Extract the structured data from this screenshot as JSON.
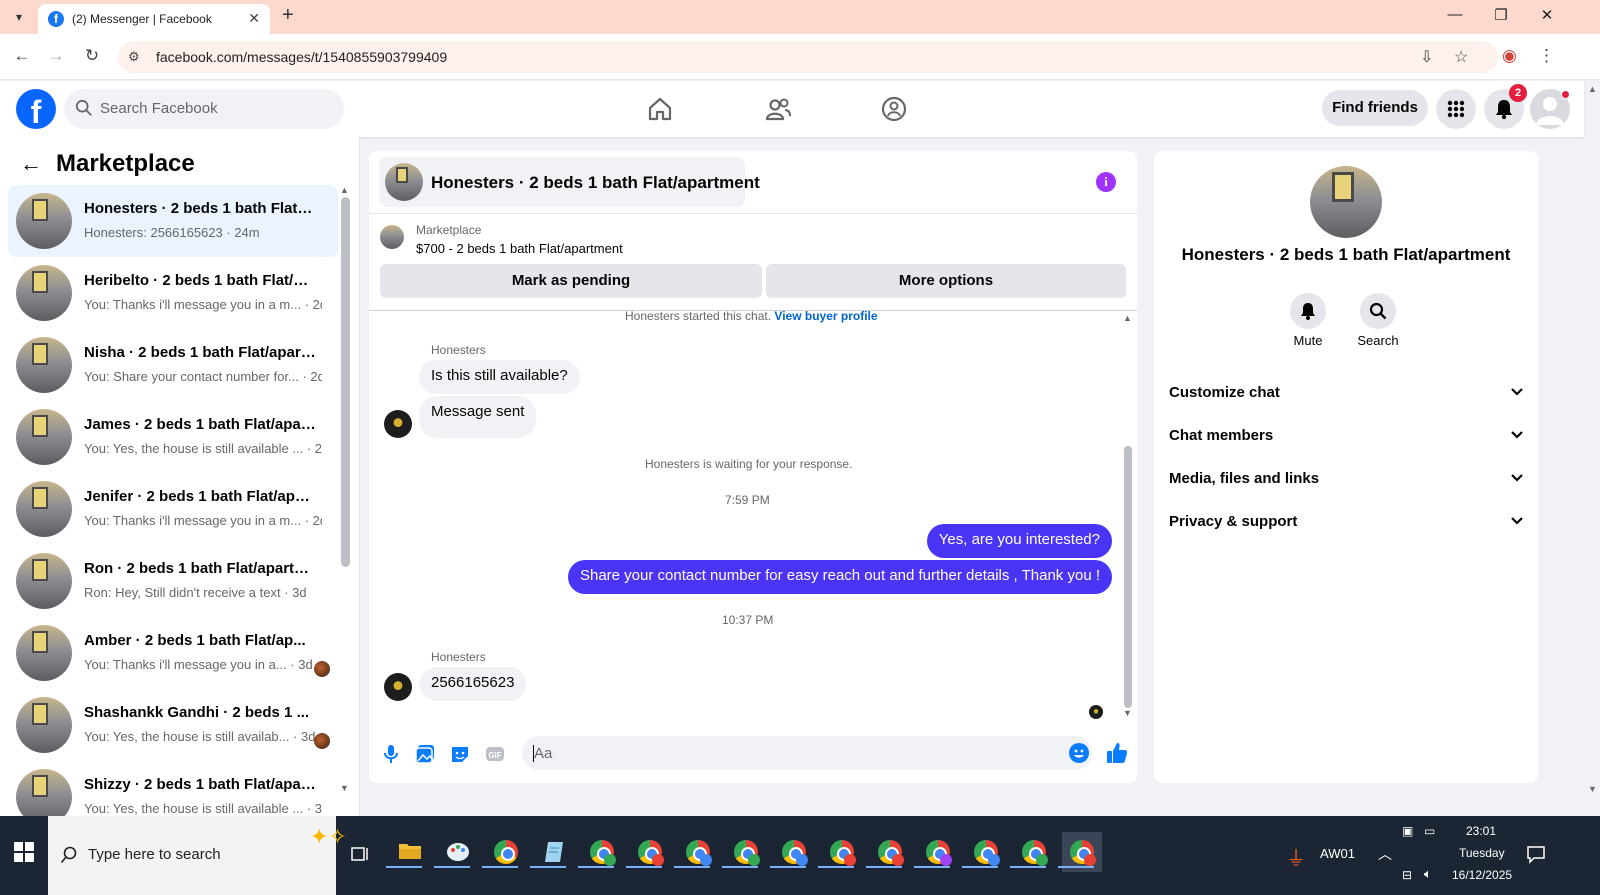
{
  "browser": {
    "tab_title": "(2) Messenger | Facebook",
    "url": "facebook.com/messages/t/1540855903799409",
    "new_tab_glyph": "+",
    "close_glyph": "✕",
    "minimize_glyph": "—",
    "maximize_glyph": "❐",
    "window_close_glyph": "✕"
  },
  "fb_header": {
    "logo": "f",
    "search_placeholder": "Search Facebook",
    "find_friends": "Find friends",
    "notification_count": "2"
  },
  "left_panel": {
    "back_glyph": "←",
    "title": "Marketplace",
    "conversations": [
      {
        "name": "Honesters · 2 beds 1 bath Flat/a...",
        "preview": "Honesters: 2566165623 · 24m",
        "active": true
      },
      {
        "name": "Heribelto · 2 beds 1 bath Flat/ap...",
        "preview": "You: Thanks i'll message you in a m... · 2d"
      },
      {
        "name": "Nisha · 2 beds 1 bath Flat/apart...",
        "preview": "You: Share your contact number for... · 2d"
      },
      {
        "name": "James · 2 beds 1 bath Flat/apart...",
        "preview": "You: Yes, the house is still available ... · 2d"
      },
      {
        "name": "Jenifer · 2 beds 1 bath Flat/apart...",
        "preview": "You: Thanks i'll message you in a m... · 2d"
      },
      {
        "name": "Ron · 2 beds 1 bath Flat/apartm...",
        "preview": "Ron: Hey, Still didn't receive a text · 3d"
      },
      {
        "name": "Amber · 2 beds 1 bath Flat/ap...",
        "preview": "You: Thanks i'll message you in a... · 3d",
        "read_avatar": true
      },
      {
        "name": "Shashankk Gandhi · 2 beds 1 ...",
        "preview": "You: Yes, the house is still availab... · 3d",
        "read_avatar": true
      },
      {
        "name": "Shizzy · 2 beds 1 bath Flat/apart...",
        "preview": "You: Yes, the house is still available ... · 3d"
      }
    ]
  },
  "chat": {
    "title": "Honesters · 2 beds 1 bath Flat/apartment",
    "info_glyph": "i",
    "listing": {
      "source": "Marketplace",
      "title": "$700 - 2 beds 1 bath Flat/apartment"
    },
    "mark_pending": "Mark as pending",
    "more_options": "More options",
    "started_text": "Honesters started this chat.",
    "view_buyer_profile": "View buyer profile",
    "sender_name": "Honesters",
    "msg_in_1": "Is this still available?",
    "msg_in_2": "Message sent",
    "waiting_text": "Honesters is waiting for your response.",
    "time_1": "7:59 PM",
    "msg_out_1": "Yes, are you interested?",
    "msg_out_2": "Share your contact number for easy reach out and further details , Thank you !",
    "time_2": "10:37 PM",
    "sender_name_2": "Honesters",
    "msg_in_3": "2566165623",
    "composer_placeholder": "Aa"
  },
  "right_panel": {
    "name": "Honesters · 2 beds 1 bath Flat/apartment",
    "mute": "Mute",
    "search": "Search",
    "sections": [
      "Customize chat",
      "Chat members",
      "Media, files and links",
      "Privacy & support"
    ]
  },
  "taskbar": {
    "search_placeholder": "Type here to search",
    "tray_label": "AW01",
    "time": "23:01",
    "day": "Tuesday",
    "date": "16/12/2025"
  },
  "colors": {
    "fb_blue": "#0866ff",
    "outgoing_bubble": "#4a34f5",
    "info_purple": "#a033ff",
    "active_conversation": "#ebf3ff"
  },
  "icons": {
    "nav": [
      "home-icon",
      "friends-icon",
      "groups-icon"
    ],
    "composer": [
      "mic-icon",
      "photo-icon",
      "sticker-icon",
      "gif-icon",
      "emoji-icon",
      "like-icon"
    ]
  }
}
